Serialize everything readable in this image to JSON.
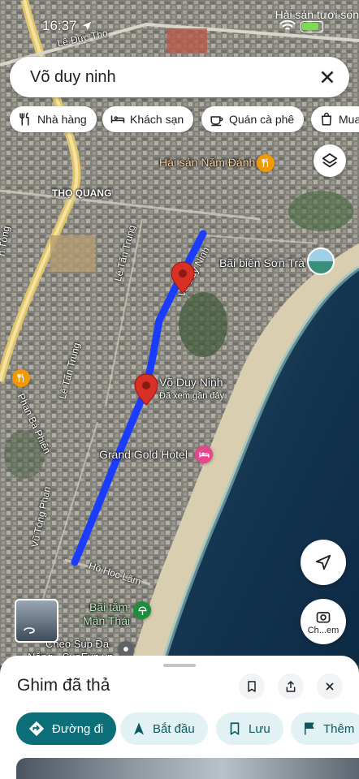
{
  "status_bar": {
    "time": "16:37",
    "notification": "Hải sản tươi sốn"
  },
  "search": {
    "query": "Võ duy ninh"
  },
  "chips": [
    {
      "label": "Nhà hàng",
      "icon": "restaurant-icon"
    },
    {
      "label": "Khách sạn",
      "icon": "hotel-icon"
    },
    {
      "label": "Quán cà phê",
      "icon": "coffee-icon"
    },
    {
      "label": "Mua",
      "icon": "shopping-bag-icon"
    }
  ],
  "map": {
    "road_labels": {
      "le_duc_tho": "Lê Đức Thọ",
      "tho_quang": "THỌ QUANG",
      "le_tan_trung_1": "Lê Tấn Trung",
      "le_tan_trung_2": "Lê Tấn Trung",
      "ho_hoc_lam": "Hồ Học Lãm",
      "vu_tong_phan": "Vũ Tông Phan",
      "phan_ba_phien": "Phan Bá Phiến",
      "an_tong": "n Tông",
      "vo_duy_ninh_road": "Võ Duy Ninh"
    },
    "poi": {
      "hai_san": "Hải sản Năm Đảnh",
      "bai_bien": "Bãi biển Sơn Trà",
      "grand_gold": "Grand Gold Hotel",
      "bai_tam_1": "Bãi tắm",
      "bai_tam_2": "Mân Thái",
      "cheo_sup_1": "Chèo Súp Đà",
      "cheo_sup_2": "Nẵng - SupFun.vn"
    },
    "pin": {
      "name": "Võ Duy Ninh",
      "subtitle": "Đã xem gần đây"
    },
    "camera_button_label": "Ch...em",
    "route_color": "#1a3cff",
    "pin_color": "#d93025"
  },
  "sheet": {
    "title": "Ghim đã thả",
    "actions": [
      {
        "label": "Đường đi",
        "icon": "directions-icon"
      },
      {
        "label": "Bắt đầu",
        "icon": "navigation-arrow-icon"
      },
      {
        "label": "Lưu",
        "icon": "bookmark-icon"
      },
      {
        "label": "Thêm",
        "icon": "flag-icon"
      }
    ],
    "accent_color": "#0b6e78"
  }
}
